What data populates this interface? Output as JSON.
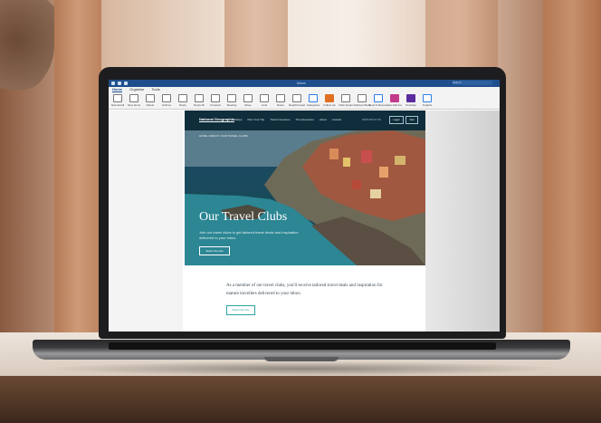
{
  "outlook": {
    "title": "Inbox",
    "search_placeholder": "Search",
    "tabs": [
      {
        "label": "Home"
      },
      {
        "label": "Organise"
      },
      {
        "label": "Tools"
      }
    ],
    "ribbon": [
      {
        "label": "New Email",
        "icon": "new-email-icon"
      },
      {
        "label": "New Items",
        "icon": "new-items-icon"
      },
      {
        "label": "Delete",
        "icon": "delete-icon"
      },
      {
        "label": "Archive",
        "icon": "archive-icon"
      },
      {
        "label": "Reply",
        "icon": "reply-icon"
      },
      {
        "label": "Reply All",
        "icon": "reply-all-icon"
      },
      {
        "label": "Forward",
        "icon": "forward-icon"
      },
      {
        "label": "Meeting",
        "icon": "meeting-icon"
      },
      {
        "label": "Move",
        "icon": "move-icon"
      },
      {
        "label": "Junk",
        "icon": "junk-icon"
      },
      {
        "label": "Rules",
        "icon": "rules-icon"
      },
      {
        "label": "Read/Unread",
        "icon": "read-unread-icon"
      },
      {
        "label": "Categorise",
        "icon": "categorise-icon"
      },
      {
        "label": "Follow Up",
        "icon": "flag-icon"
      },
      {
        "label": "Filter Email",
        "icon": "filter-icon"
      },
      {
        "label": "Address Book",
        "icon": "address-book-icon"
      },
      {
        "label": "Send & Receive",
        "icon": "send-receive-icon"
      },
      {
        "label": "Get Add-ins",
        "icon": "add-ins-icon"
      },
      {
        "label": "OneNote",
        "icon": "onenote-icon"
      },
      {
        "label": "Insights",
        "icon": "insights-icon"
      }
    ]
  },
  "email": {
    "brand": "National Geographic",
    "nav": [
      "Holidays",
      "Plan Your Trip",
      "Travel Insurance",
      "The Adventurer",
      "About",
      "Contact"
    ],
    "phone": "0345 053 07 00",
    "login": "Login",
    "join": "Join",
    "breadcrumb": "HOME / ABOUT / OUR TRAVEL CLUBS",
    "hero_title": "Our Travel Clubs",
    "hero_sub": "Join our travel clubs to get tailored travel deals and inspiration delivered to your inbox.",
    "hero_button": "Select the trav",
    "body_text": "As a member of our travel clubs, you'll receive tailored travel deals and inspiration for mature travellers delivered to your inbox.",
    "body_button": "Select the trav"
  }
}
